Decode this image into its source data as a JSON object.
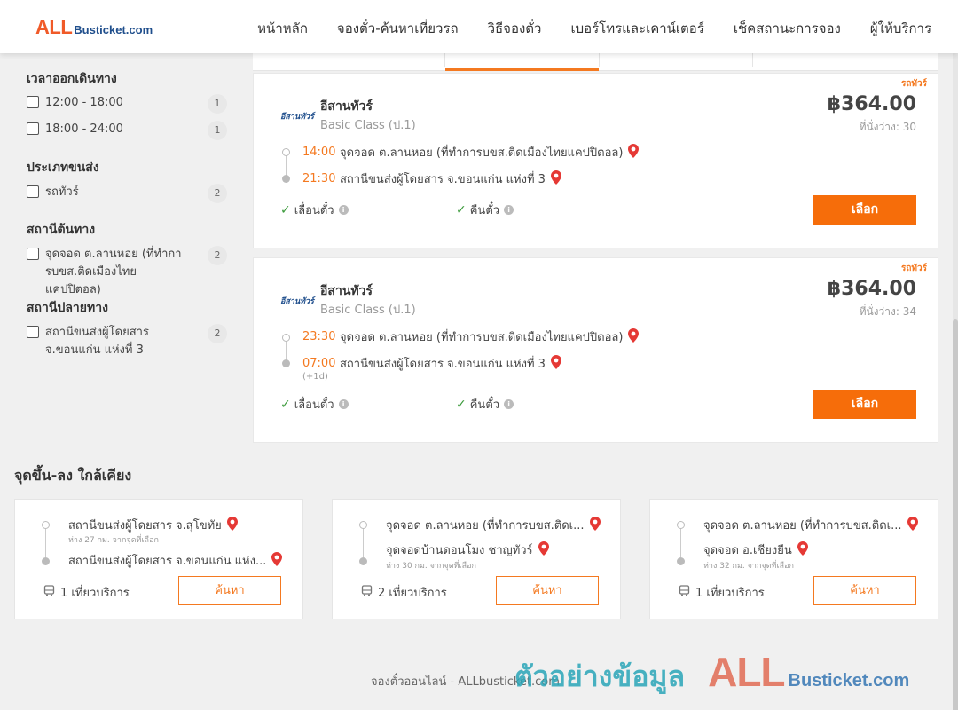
{
  "header": {
    "logo_all": "ALL",
    "logo_rest": "Busticket.com",
    "nav": [
      "หน้าหลัก",
      "จองตั๋ว-ค้นหาเที่ยวรถ",
      "วิธีจองตั๋ว",
      "เบอร์โทรและเคาน์เตอร์",
      "เช็คสถานะการจอง",
      "ผู้ให้บริการ"
    ]
  },
  "filters": {
    "departure_time": {
      "title": "เวลาออกเดินทาง",
      "options": [
        {
          "label": "12:00 - 18:00",
          "count": "1"
        },
        {
          "label": "18:00 - 24:00",
          "count": "1"
        }
      ]
    },
    "transport_type": {
      "title": "ประเภทขนส่ง",
      "options": [
        {
          "label": "รถทัวร์",
          "count": "2"
        }
      ]
    },
    "origin": {
      "title": "สถานีต้นทาง",
      "options": [
        {
          "label": "จุดจอด ต.ลานหอย (ที่ทำการบขส.ติดเมืองไทยแคปปิตอล)",
          "count": "2"
        }
      ]
    },
    "destination": {
      "title": "สถานีปลายทาง",
      "options": [
        {
          "label": "สถานีขนส่งผู้โดยสาร จ.ขอนแก่น แห่งที่ 3",
          "count": "2"
        }
      ]
    }
  },
  "trips": [
    {
      "tag": "รถทัวร์",
      "operator_logo": "อีสานทัวร์",
      "operator": "อีสานทัวร์",
      "class": "Basic Class (ป.1)",
      "price": "฿364.00",
      "seats": "ที่นั่งว่าง: 30",
      "depart_time": "14:00",
      "depart_stop": "จุดจอด ต.ลานหอย (ที่ทำการบขส.ติดเมืองไทยแคปปิตอล)",
      "arrive_time": "21:30",
      "arrive_stop": "สถานีขนส่งผู้โดยสาร จ.ขอนแก่น แห่งที่ 3",
      "plus_day": "",
      "policy_change": "เลื่อนตั๋ว",
      "policy_refund": "คืนตั๋ว",
      "select_label": "เลือก"
    },
    {
      "tag": "รถทัวร์",
      "operator_logo": "อีสานทัวร์",
      "operator": "อีสานทัวร์",
      "class": "Basic Class (ป.1)",
      "price": "฿364.00",
      "seats": "ที่นั่งว่าง: 34",
      "depart_time": "23:30",
      "depart_stop": "จุดจอด ต.ลานหอย (ที่ทำการบขส.ติดเมืองไทยแคปปิตอล)",
      "arrive_time": "07:00",
      "arrive_stop": "สถานีขนส่งผู้โดยสาร จ.ขอนแก่น แห่งที่ 3",
      "plus_day": "(+1d)",
      "policy_change": "เลื่อนตั๋ว",
      "policy_refund": "คืนตั๋ว",
      "select_label": "เลือก"
    }
  ],
  "nearby": {
    "title": "จุดขึ้น-ลง ใกล้เคียง",
    "items": [
      {
        "stop_top": "สถานีขนส่งผู้โดยสาร จ.สุโขทัย",
        "sub_top": "ห่าง 27 กม. จากจุดที่เลือก",
        "stop_bottom": "สถานีขนส่งผู้โดยสาร จ.ขอนแก่น แห่ง...",
        "sub_bottom": "",
        "trips": "1 เที่ยวบริการ",
        "button": "ค้นหา"
      },
      {
        "stop_top": "จุดจอด ต.ลานหอย (ที่ทำการบขส.ติดเ...",
        "sub_top": "",
        "stop_bottom": "จุดจอดบ้านดอนโมง ชาญทัวร์",
        "sub_bottom": "ห่าง 30 กม. จากจุดที่เลือก",
        "trips": "2 เที่ยวบริการ",
        "button": "ค้นหา"
      },
      {
        "stop_top": "จุดจอด ต.ลานหอย (ที่ทำการบขส.ติดเ...",
        "sub_top": "",
        "stop_bottom": "จุดจอด อ.เชียงยืน",
        "sub_bottom": "ห่าง 32 กม. จากจุดที่เลือก",
        "trips": "1 เที่ยวบริการ",
        "button": "ค้นหา"
      }
    ]
  },
  "footer": {
    "text": "จองตั๋วออนไลน์ - ALLbusticket.com"
  },
  "watermark": {
    "thai": "ตัวอย่างข้อมูล",
    "all": "ALL",
    "rest": "Busticket.com"
  },
  "colors": {
    "accent": "#f47920",
    "button": "#f66d0a",
    "pin": "#e53935",
    "check": "#3a9a3a"
  }
}
